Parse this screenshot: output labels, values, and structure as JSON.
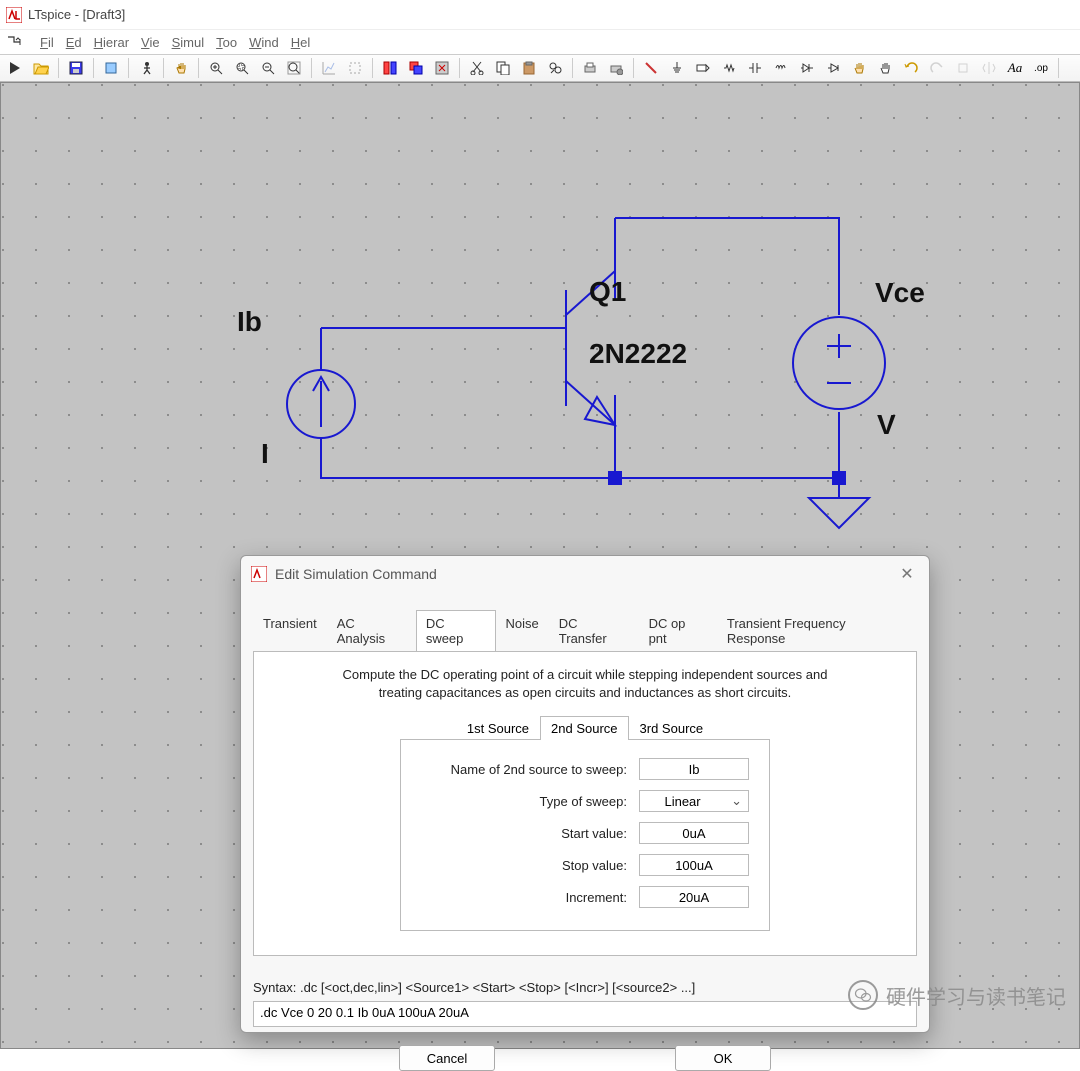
{
  "app": {
    "title": "LTspice - [Draft3]"
  },
  "menu": [
    "Fil",
    "Ed",
    "Hierar",
    "Vie",
    "Simul",
    "Too",
    "Wind",
    "Hel"
  ],
  "schematic": {
    "ib_label": "Ib",
    "i_label": "I",
    "q_label": "Q1",
    "q_value": "2N2222",
    "vce_label": "Vce",
    "v_label": "V"
  },
  "dialog": {
    "title": "Edit Simulation Command",
    "tabs": [
      "Transient",
      "AC Analysis",
      "DC sweep",
      "Noise",
      "DC Transfer",
      "DC op pnt",
      "Transient Frequency Response"
    ],
    "active_tab": "DC sweep",
    "description1": "Compute the DC operating point of a circuit while stepping independent sources and",
    "description2": "treating capacitances as open circuits and inductances as short circuits.",
    "src_tabs": [
      "1st Source",
      "2nd Source",
      "3rd Source"
    ],
    "active_src_tab": "2nd Source",
    "fields": {
      "name_label": "Name of 2nd source to sweep:",
      "name_value": "Ib",
      "type_label": "Type of sweep:",
      "type_value": "Linear",
      "start_label": "Start value:",
      "start_value": "0uA",
      "stop_label": "Stop value:",
      "stop_value": "100uA",
      "incr_label": "Increment:",
      "incr_value": "20uA"
    },
    "syntax_label": "Syntax:   .dc [<oct,dec,lin>] <Source1> <Start> <Stop> [<Incr>] [<source2> ...]",
    "command": ".dc Vce 0 20 0.1 Ib 0uA 100uA 20uA",
    "cancel": "Cancel",
    "ok": "OK"
  },
  "watermark": "硬件学习与读书笔记"
}
